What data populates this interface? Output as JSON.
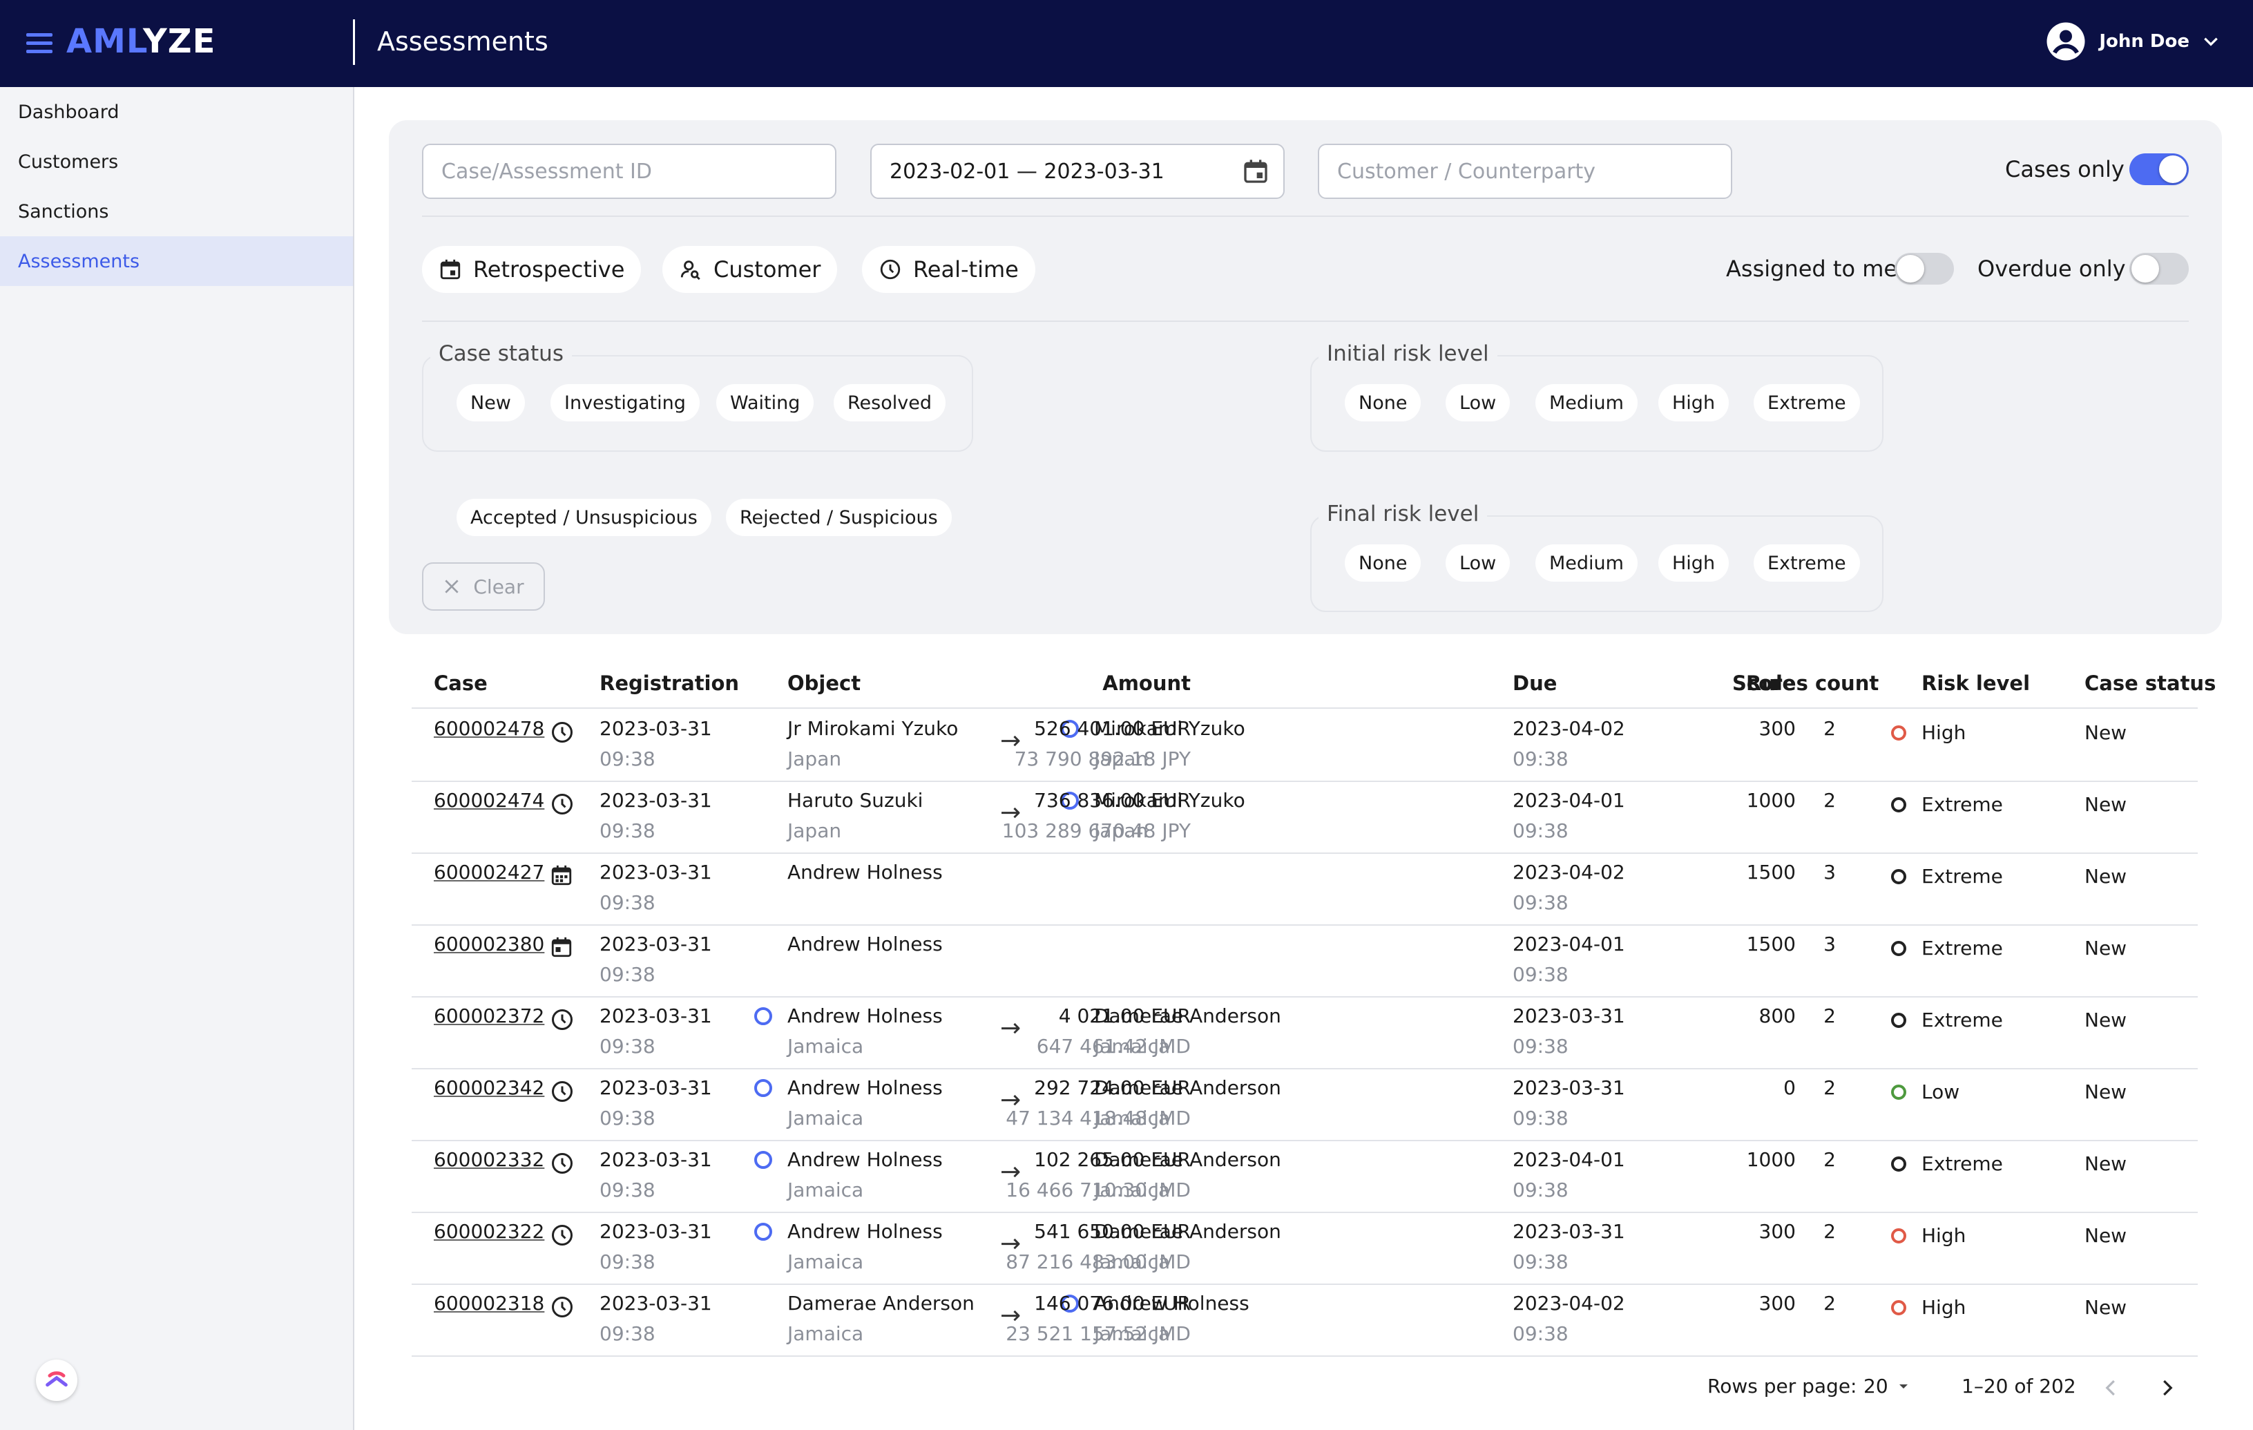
{
  "header": {
    "brand_part1": "AML",
    "brand_part2": "YZE",
    "page_title": "Assessments",
    "user_name": "John Doe"
  },
  "sidebar": {
    "items": [
      {
        "label": "Dashboard"
      },
      {
        "label": "Customers"
      },
      {
        "label": "Sanctions"
      },
      {
        "label": "Assessments",
        "active": true
      }
    ]
  },
  "filters": {
    "case_id_placeholder": "Case/Assessment ID",
    "date_range": "2023-02-01 — 2023-03-31",
    "customer_placeholder": "Customer / Counterparty",
    "cases_only_label": "Cases only",
    "cases_only": true,
    "type_chips": [
      "Retrospective",
      "Customer",
      "Real-time"
    ],
    "assigned_label": "Assigned to me",
    "assigned": false,
    "overdue_label": "Overdue only",
    "overdue": false,
    "case_status_legend": "Case status",
    "case_status_chips": [
      "New",
      "Investigating",
      "Waiting",
      "Resolved"
    ],
    "resolution_chips": [
      "Accepted / Unsuspicious",
      "Rejected / Suspicious"
    ],
    "initial_risk_legend": "Initial risk level",
    "final_risk_legend": "Final risk level",
    "risk_chips": [
      "None",
      "Low",
      "Medium",
      "High",
      "Extreme"
    ],
    "clear_label": "Clear"
  },
  "table": {
    "headers": {
      "case": "Case",
      "registration": "Registration",
      "object": "Object",
      "amount": "Amount",
      "due": "Due",
      "score": "Score",
      "rules_count": "Rules count",
      "risk_level": "Risk level",
      "case_status": "Case status"
    },
    "rows": [
      {
        "case": "600002478",
        "type": "realtime",
        "reg_date": "2023-03-31",
        "reg_time": "09:38",
        "obj_name": "Jr Mirokami Yzuko",
        "obj_country": "Japan",
        "obj_ring": false,
        "arrow": "→",
        "cp_name": "Mirokami Yzuko",
        "cp_country": "Japan",
        "cp_ring": true,
        "amount": "526 401.00 EUR",
        "amount_sub": "73 790 892.18 JPY",
        "due_date": "2023-04-02",
        "due_time": "09:38",
        "score": "300",
        "rules": "2",
        "risk": "High",
        "risk_color": "#e05a47",
        "status": "New"
      },
      {
        "case": "600002474",
        "type": "realtime",
        "reg_date": "2023-03-31",
        "reg_time": "09:38",
        "obj_name": "Haruto Suzuki",
        "obj_country": "Japan",
        "obj_ring": false,
        "arrow": "→",
        "cp_name": "Mirokami Yzuko",
        "cp_country": "Japan",
        "cp_ring": true,
        "amount": "736 836.00 EUR",
        "amount_sub": "103 289 670.48 JPY",
        "due_date": "2023-04-01",
        "due_time": "09:38",
        "score": "1000",
        "rules": "2",
        "risk": "Extreme",
        "risk_color": "#222222",
        "status": "New"
      },
      {
        "case": "600002427",
        "type": "retrospective",
        "reg_date": "2023-03-31",
        "reg_time": "09:38",
        "obj_name": "Andrew Holness",
        "obj_country": "",
        "obj_ring": false,
        "arrow": "",
        "cp_name": "",
        "cp_country": "",
        "cp_ring": false,
        "amount": "",
        "amount_sub": "",
        "due_date": "2023-04-02",
        "due_time": "09:38",
        "score": "1500",
        "rules": "3",
        "risk": "Extreme",
        "risk_color": "#222222",
        "status": "New"
      },
      {
        "case": "600002380",
        "type": "customer",
        "reg_date": "2023-03-31",
        "reg_time": "09:38",
        "obj_name": "Andrew Holness",
        "obj_country": "",
        "obj_ring": false,
        "arrow": "",
        "cp_name": "",
        "cp_country": "",
        "cp_ring": false,
        "amount": "",
        "amount_sub": "",
        "due_date": "2023-04-01",
        "due_time": "09:38",
        "score": "1500",
        "rules": "3",
        "risk": "Extreme",
        "risk_color": "#222222",
        "status": "New"
      },
      {
        "case": "600002372",
        "type": "realtime",
        "reg_date": "2023-03-31",
        "reg_time": "09:38",
        "obj_name": "Andrew Holness",
        "obj_country": "Jamaica",
        "obj_ring": true,
        "arrow": "→",
        "cp_name": "Damerae Anderson",
        "cp_country": "Jamaica",
        "cp_ring": false,
        "amount": "4 021.00 EUR",
        "amount_sub": "647 461.42 JMD",
        "due_date": "2023-03-31",
        "due_time": "09:38",
        "score": "800",
        "rules": "2",
        "risk": "Extreme",
        "risk_color": "#222222",
        "status": "New"
      },
      {
        "case": "600002342",
        "type": "realtime",
        "reg_date": "2023-03-31",
        "reg_time": "09:38",
        "obj_name": "Andrew Holness",
        "obj_country": "Jamaica",
        "obj_ring": true,
        "arrow": "→",
        "cp_name": "Damerae Anderson",
        "cp_country": "Jamaica",
        "cp_ring": false,
        "amount": "292 724.00 EUR",
        "amount_sub": "47 134 418.48 JMD",
        "due_date": "2023-03-31",
        "due_time": "09:38",
        "score": "0",
        "rules": "2",
        "risk": "Low",
        "risk_color": "#4e9a3e",
        "status": "New"
      },
      {
        "case": "600002332",
        "type": "realtime",
        "reg_date": "2023-03-31",
        "reg_time": "09:38",
        "obj_name": "Andrew Holness",
        "obj_country": "Jamaica",
        "obj_ring": true,
        "arrow": "→",
        "cp_name": "Damerae Anderson",
        "cp_country": "Jamaica",
        "cp_ring": false,
        "amount": "102 265.00 EUR",
        "amount_sub": "16 466 710.30 JMD",
        "due_date": "2023-04-01",
        "due_time": "09:38",
        "score": "1000",
        "rules": "2",
        "risk": "Extreme",
        "risk_color": "#222222",
        "status": "New"
      },
      {
        "case": "600002322",
        "type": "realtime",
        "reg_date": "2023-03-31",
        "reg_time": "09:38",
        "obj_name": "Andrew Holness",
        "obj_country": "Jamaica",
        "obj_ring": true,
        "arrow": "→",
        "cp_name": "Damerae Anderson",
        "cp_country": "Jamaica",
        "cp_ring": false,
        "amount": "541 650.00 EUR",
        "amount_sub": "87 216 483.00 JMD",
        "due_date": "2023-03-31",
        "due_time": "09:38",
        "score": "300",
        "rules": "2",
        "risk": "High",
        "risk_color": "#e05a47",
        "status": "New"
      },
      {
        "case": "600002318",
        "type": "realtime",
        "reg_date": "2023-03-31",
        "reg_time": "09:38",
        "obj_name": "Damerae Anderson",
        "obj_country": "Jamaica",
        "obj_ring": false,
        "arrow": "→",
        "cp_name": "Andrew Holness",
        "cp_country": "Jamaica",
        "cp_ring": true,
        "amount": "146 076.00 EUR",
        "amount_sub": "23 521 157.52 JMD",
        "due_date": "2023-04-02",
        "due_time": "09:38",
        "score": "300",
        "rules": "2",
        "risk": "High",
        "risk_color": "#e05a47",
        "status": "New"
      }
    ]
  },
  "pagination": {
    "rows_per_page_label": "Rows per page:",
    "rows_per_page": "20",
    "range": "1–20 of 202"
  },
  "colors": {
    "topbar": "#0b1044",
    "accent": "#4d6bf2",
    "panel_bg": "#f1f2f5"
  }
}
